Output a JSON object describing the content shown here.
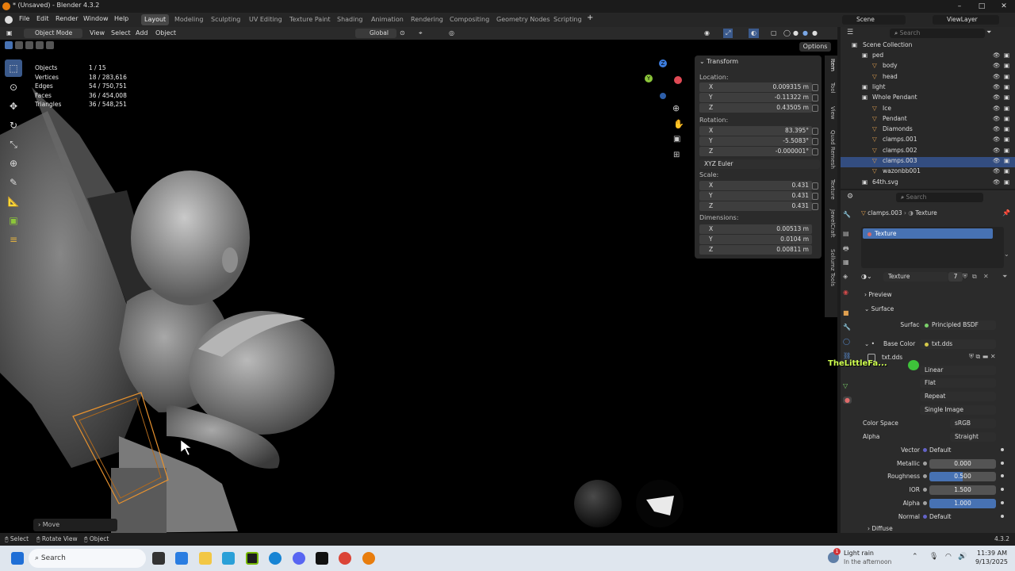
{
  "app": {
    "title": "* (Unsaved) - Blender 4.3.2",
    "version": "4.3.2"
  },
  "menu": [
    "File",
    "Edit",
    "Render",
    "Window",
    "Help"
  ],
  "workspaces": [
    "Layout",
    "Modeling",
    "Sculpting",
    "UV Editing",
    "Texture Paint",
    "Shading",
    "Animation",
    "Rendering",
    "Compositing",
    "Geometry Nodes",
    "Scripting"
  ],
  "active_workspace": "Layout",
  "scene": {
    "name": "Scene",
    "view_layer": "ViewLayer"
  },
  "vheader": {
    "mode": "Object Mode",
    "view": "View",
    "select": "Select",
    "add": "Add",
    "object": "Object",
    "transform": "Global",
    "options": "Options"
  },
  "stats": [
    {
      "label": "Objects",
      "value": "1 / 15"
    },
    {
      "label": "Vertices",
      "value": "18 / 283,616"
    },
    {
      "label": "Edges",
      "value": "54 / 750,751"
    },
    {
      "label": "Faces",
      "value": "36 / 454,008"
    },
    {
      "label": "Triangles",
      "value": "36 / 548,251"
    }
  ],
  "npanel": {
    "title": "Transform",
    "location_label": "Location:",
    "location": [
      {
        "ax": "X",
        "v": "0.009315 m"
      },
      {
        "ax": "Y",
        "v": "-0.11322 m"
      },
      {
        "ax": "Z",
        "v": "0.43505 m"
      }
    ],
    "rotation_label": "Rotation:",
    "rotation": [
      {
        "ax": "X",
        "v": "83.395°"
      },
      {
        "ax": "Y",
        "v": "-5.5083°"
      },
      {
        "ax": "Z",
        "v": "-0.000001°"
      }
    ],
    "rotation_mode": "XYZ Euler",
    "scale_label": "Scale:",
    "scale": [
      {
        "ax": "X",
        "v": "0.431"
      },
      {
        "ax": "Y",
        "v": "0.431"
      },
      {
        "ax": "Z",
        "v": "0.431"
      }
    ],
    "dimensions_label": "Dimensions:",
    "dimensions": [
      {
        "ax": "X",
        "v": "0.00513 m"
      },
      {
        "ax": "Y",
        "v": "0.0104 m"
      },
      {
        "ax": "Z",
        "v": "0.00811 m"
      }
    ]
  },
  "side_tabs": [
    "Item",
    "Tool",
    "View",
    "Quad Remesh",
    "Texture",
    "JewelCraft",
    "Sollumz Tools"
  ],
  "outliner": {
    "search": "Search",
    "root": "Scene Collection",
    "rows": [
      {
        "name": "ped",
        "indent": 1
      },
      {
        "name": "body",
        "indent": 2
      },
      {
        "name": "head",
        "indent": 2
      },
      {
        "name": "light",
        "indent": 1
      },
      {
        "name": "Whole Pendant",
        "indent": 1
      },
      {
        "name": "Ice",
        "indent": 2
      },
      {
        "name": "Pendant",
        "indent": 2
      },
      {
        "name": "Diamonds",
        "indent": 2
      },
      {
        "name": "clamps.001",
        "indent": 2
      },
      {
        "name": "clamps.002",
        "indent": 2
      },
      {
        "name": "clamps.003",
        "indent": 2,
        "selected": true
      },
      {
        "name": "wazonbb001",
        "indent": 2
      },
      {
        "name": "64th.svg",
        "indent": 1
      }
    ]
  },
  "props": {
    "search": "Search",
    "object": "clamps.003",
    "material_tab": "Texture",
    "slot": "Texture",
    "material_name": "Texture",
    "users": "7",
    "preview": "Preview",
    "surface": "Surface",
    "surface_label": "Surface",
    "surface_value": "Principled BSDF",
    "base_color_label": "Base Color",
    "base_color_value": "txt.dds",
    "image_name": "txt.dds",
    "overlay_text": "TheLittleFa...",
    "interp": "Linear",
    "projection": "Flat",
    "extension": "Repeat",
    "source": "Single Image",
    "color_space_label": "Color Space",
    "color_space": "sRGB",
    "alpha_label": "Alpha",
    "alpha_mode": "Straight",
    "inputs": [
      {
        "label": "Vector",
        "value": "Default",
        "kind": "socket"
      },
      {
        "label": "Metallic",
        "value": "0.000",
        "kind": "num"
      },
      {
        "label": "Roughness",
        "value": "0.500",
        "kind": "slider",
        "fill": 0.5
      },
      {
        "label": "IOR",
        "value": "1.500",
        "kind": "num"
      },
      {
        "label": "Alpha",
        "value": "1.000",
        "kind": "slider",
        "fill": 1.0
      },
      {
        "label": "Normal",
        "value": "Default",
        "kind": "socket"
      }
    ],
    "diffuse": "Diffuse"
  },
  "status": {
    "select": "Select",
    "rotate": "Rotate View",
    "object": "Object",
    "move_panel": "Move"
  },
  "taskbar": {
    "search": "Search",
    "weather": "Light rain",
    "weather_sub": "In the afternoon",
    "time": "11:39 AM",
    "date": "9/13/2025",
    "badge": "1"
  }
}
